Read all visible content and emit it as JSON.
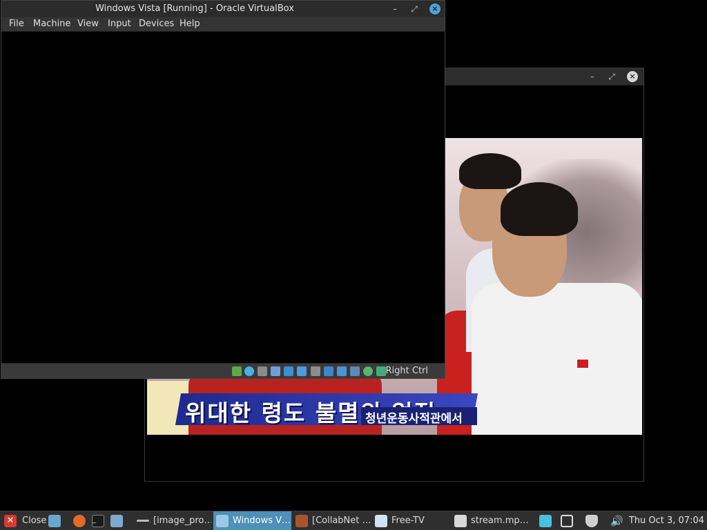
{
  "vbox": {
    "title": "Windows Vista [Running] - Oracle VirtualBox",
    "menu": [
      "File",
      "Machine",
      "View",
      "Input",
      "Devices",
      "Help"
    ],
    "host_key": "Right Ctrl",
    "status_icons": [
      "hard-disk-icon",
      "optical-disk-icon",
      "floppy-icon",
      "audio-icon",
      "network-icon",
      "usb-icon",
      "shared-folder-icon",
      "display-icon",
      "video-capture-icon",
      "cpu-icon",
      "mouse-integration-icon",
      "keyboard-icon"
    ]
  },
  "player": {
    "banner_main": "위대한 령도 불멸의 업적",
    "banner_sub": "청년운동사적관에서"
  },
  "taskbar": {
    "close_label": "Close",
    "items": [
      {
        "label": "[image_pro…",
        "icon": "terminal-icon"
      },
      {
        "label": "Windows V…",
        "icon": "virtualbox-icon",
        "active": true
      },
      {
        "label": "[CollabNet …",
        "icon": "app-icon"
      },
      {
        "label": "Free-TV",
        "icon": "tv-icon"
      },
      {
        "label": "stream.mp…",
        "icon": "video-file-icon"
      }
    ],
    "clock": "Thu Oct  3, 07:04"
  }
}
